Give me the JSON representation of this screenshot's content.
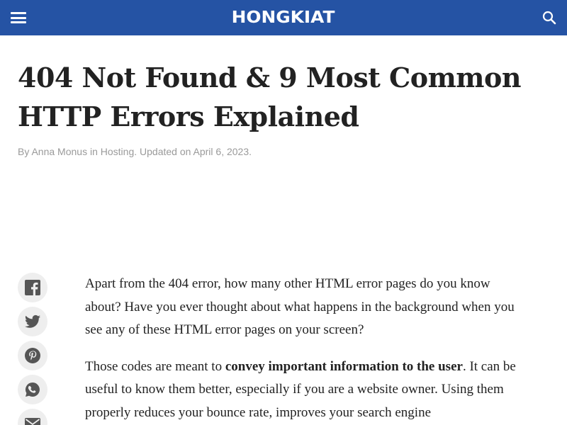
{
  "header": {
    "logo": "HONGKIAT",
    "menu_icon": "hamburger-menu-icon",
    "search_icon": "search-icon",
    "bg_color": "#2553a4"
  },
  "article": {
    "title_line1": "404 Not Found & 9 Most Common",
    "title_line2": "HTTP Errors Explained",
    "meta": {
      "by": "By ",
      "author": "Anna Monus",
      "in": " in ",
      "category": "Hosting",
      "updated": ". Updated on April 6, 2023."
    },
    "paragraphs": [
      {
        "text": "Apart from the 404 error, how many other HTML error pages do you know about? Have you ever thought about what happens in the background when you see any of these HTML error pages on your screen?"
      },
      {
        "before": "Those codes are meant to ",
        "bold": "convey important information to the user",
        "after": ". It can be useful to know them better, especially if you are a website owner. Using them properly reduces your bounce rate, improves your search engine"
      }
    ]
  },
  "share": [
    {
      "name": "facebook",
      "icon": "facebook-icon"
    },
    {
      "name": "twitter",
      "icon": "twitter-icon"
    },
    {
      "name": "pinterest",
      "icon": "pinterest-icon"
    },
    {
      "name": "whatsapp",
      "icon": "whatsapp-icon"
    },
    {
      "name": "email",
      "icon": "email-icon"
    }
  ]
}
